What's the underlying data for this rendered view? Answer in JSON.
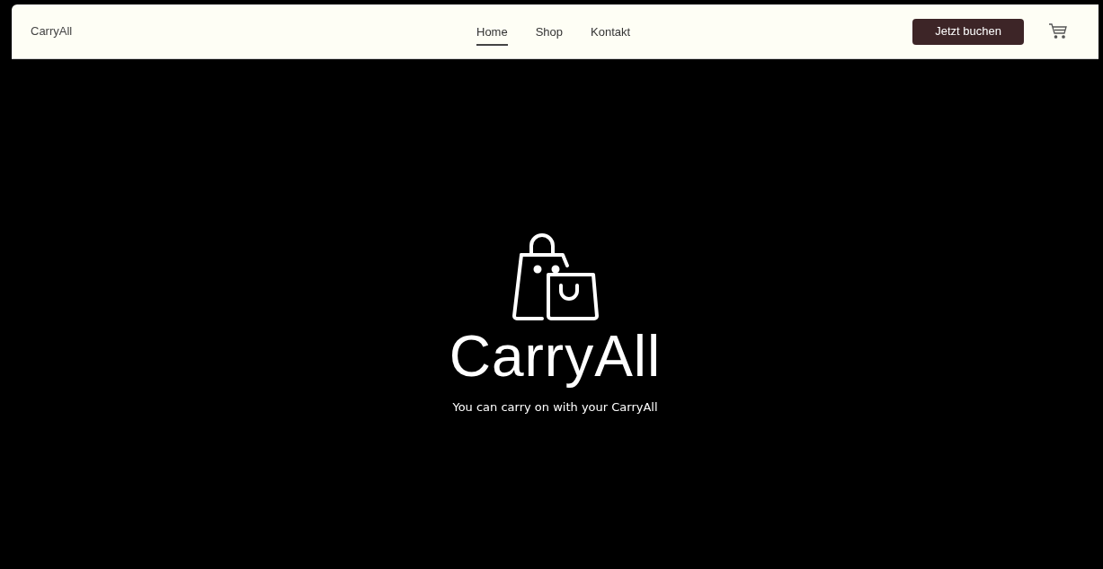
{
  "header": {
    "brand": "CarryAll",
    "nav": [
      {
        "label": "Home",
        "selected": true
      },
      {
        "label": "Shop",
        "selected": false
      },
      {
        "label": "Kontakt",
        "selected": false
      }
    ],
    "cta_button": "Jetzt buchen"
  },
  "hero": {
    "logo_text": "CarryAll",
    "tagline": "You can carry on with your CarryAll"
  }
}
